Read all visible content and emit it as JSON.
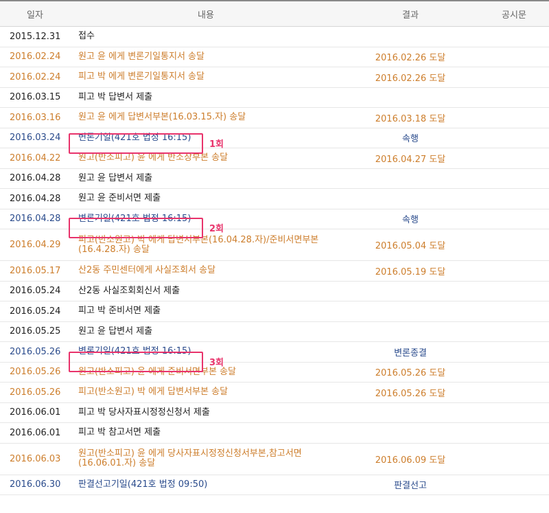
{
  "header": {
    "date": "일자",
    "content": "내용",
    "result": "결과",
    "notice": "공시문"
  },
  "rows": [
    {
      "date": "2015.12.31",
      "content": "접수",
      "result": ""
    },
    {
      "date": "2016.02.24",
      "content": "원고 윤 에게 변론기일통지서 송달",
      "result": "2016.02.26 도달"
    },
    {
      "date": "2016.02.24",
      "content": "피고 박 에게 변론기일통지서 송달",
      "result": "2016.02.26 도달"
    },
    {
      "date": "2016.03.15",
      "content": "피고 박 답변서 제출",
      "result": ""
    },
    {
      "date": "2016.03.16",
      "content": "원고 윤 에게 답변서부본(16.03.15.자) 송달",
      "result": "2016.03.18 도달"
    },
    {
      "date": "2016.03.24",
      "content": "변론기일(421호 법정 16:15)",
      "result": "속행"
    },
    {
      "date": "2016.04.22",
      "content": "원고(반소피고) 윤 에게 반소장부본 송달",
      "result": "2016.04.27 도달"
    },
    {
      "date": "2016.04.28",
      "content": "원고 윤 답변서 제출",
      "result": ""
    },
    {
      "date": "2016.04.28",
      "content": "원고 윤 준비서면 제출",
      "result": ""
    },
    {
      "date": "2016.04.28",
      "content": "변론기일(421호 법정 16:15)",
      "result": "속행"
    },
    {
      "date": "2016.04.29",
      "content": "피고(반소원고) 박 에게 답변서부본(16.04.28.자)/준비서면부본 (16.4.28.자) 송달",
      "result": "2016.05.04 도달"
    },
    {
      "date": "2016.05.17",
      "content": "산2동 주민센터에게 사실조회서 송달",
      "result": "2016.05.19 도달"
    },
    {
      "date": "2016.05.24",
      "content": "산2동 사실조회회신서 제출",
      "result": ""
    },
    {
      "date": "2016.05.24",
      "content": "피고 박 준비서면 제출",
      "result": ""
    },
    {
      "date": "2016.05.25",
      "content": "원고 윤 답변서 제출",
      "result": ""
    },
    {
      "date": "2016.05.26",
      "content": "변론기일(421호 법정 16:15)",
      "result": "변론종결"
    },
    {
      "date": "2016.05.26",
      "content": "원고(반소피고) 윤 에게 준비서면부본 송달",
      "result": "2016.05.26 도달"
    },
    {
      "date": "2016.05.26",
      "content": "피고(반소원고) 박 에게 답변서부본 송달",
      "result": "2016.05.26 도달"
    },
    {
      "date": "2016.06.01",
      "content": "피고 박 당사자표시정정신청서 제출",
      "result": ""
    },
    {
      "date": "2016.06.01",
      "content": "피고 박 참고서면 제출",
      "result": ""
    },
    {
      "date": "2016.06.03",
      "content": "원고(반소피고) 윤 에게 당사자표시정정신청서부본,참고서면 (16.06.01.자) 송달",
      "result": "2016.06.09 도달"
    },
    {
      "date": "2016.06.30",
      "content": "판결선고기일(421호 법정 09:50)",
      "result": "판결선고"
    }
  ],
  "annotations": {
    "first": "1회",
    "second": "2회",
    "third": "3회"
  },
  "colors": {
    "orange": "#cd7e2c",
    "blue": "#2a4b8c",
    "black": "#222222",
    "marker": "#e8336b"
  }
}
